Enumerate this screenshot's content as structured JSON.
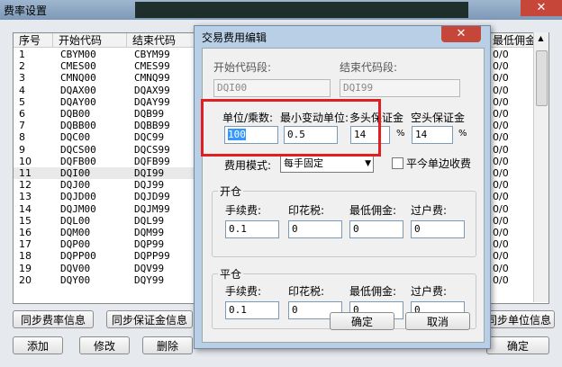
{
  "outer": {
    "title": "费率设置",
    "headers": [
      "序号",
      "开始代码",
      "结束代码"
    ],
    "right_header": "最低佣金",
    "rows": [
      [
        "1",
        "CBYM00",
        "CBYM99"
      ],
      [
        "2",
        "CMES00",
        "CMES99"
      ],
      [
        "3",
        "CMNQ00",
        "CMNQ99"
      ],
      [
        "4",
        "DQAX00",
        "DQAX99"
      ],
      [
        "5",
        "DQAY00",
        "DQAY99"
      ],
      [
        "6",
        "DQB00",
        "DQB99"
      ],
      [
        "7",
        "DQBB00",
        "DQBB99"
      ],
      [
        "8",
        "DQC00",
        "DQC99"
      ],
      [
        "9",
        "DQCS00",
        "DQCS99"
      ],
      [
        "10",
        "DQFB00",
        "DQFB99"
      ],
      [
        "11",
        "DQI00",
        "DQI99"
      ],
      [
        "12",
        "DQJ00",
        "DQJ99"
      ],
      [
        "13",
        "DQJD00",
        "DQJD99"
      ],
      [
        "14",
        "DQJM00",
        "DQJM99"
      ],
      [
        "15",
        "DQL00",
        "DQL99"
      ],
      [
        "16",
        "DQM00",
        "DQM99"
      ],
      [
        "17",
        "DQP00",
        "DQP99"
      ],
      [
        "18",
        "DQPP00",
        "DQPP99"
      ],
      [
        "19",
        "DQV00",
        "DQV99"
      ],
      [
        "20",
        "DQY00",
        "DQY99"
      ]
    ],
    "right_values": [
      "0/0",
      "0/0",
      "0/0",
      "0/0",
      "0/0",
      "0/0",
      "0/0",
      "0/0",
      "0/0",
      "0/0",
      "0/0",
      "0/0",
      "0/0",
      "0/0",
      "0/0",
      "0/0",
      "0/0",
      "0/0",
      "0/0",
      "0/0"
    ],
    "btn_sync_rate": "同步费率信息",
    "btn_sync_margin": "同步保证金信息",
    "btn_sync_unit": "同步单位信息",
    "btn_add": "添加",
    "btn_modify": "修改",
    "btn_delete": "删除",
    "btn_ok": "确定"
  },
  "dialog": {
    "title": "交易费用编辑",
    "start_label": "开始代码段:",
    "end_label": "结束代码段:",
    "start_value": "DQI00",
    "end_value": "DQI99",
    "unit_label": "单位/乘数:",
    "tick_label": "最小变动单位:",
    "long_margin_label": "多头保证金",
    "short_margin_label": "空头保证金",
    "unit_value": "100",
    "tick_value": "0.5",
    "long_margin_value": "14",
    "short_margin_value": "14",
    "percent": "%",
    "fee_mode_label": "费用模式:",
    "fee_mode_value": "每手固定",
    "close_today_label": "平今单边收费",
    "open_group": "开仓",
    "close_group": "平仓",
    "fee_label": "手续费:",
    "stamp_label": "印花税:",
    "min_comm_label": "最低佣金:",
    "transfer_label": "过户费:",
    "open": {
      "fee": "0.1",
      "stamp": "0",
      "min_comm": "0",
      "transfer": "0"
    },
    "close": {
      "fee": "0.1",
      "stamp": "0",
      "min_comm": "0",
      "transfer": "0"
    },
    "ok": "确定",
    "cancel": "取消"
  },
  "colors": {
    "highlight": "#e02020",
    "selection": "#3399ff"
  }
}
